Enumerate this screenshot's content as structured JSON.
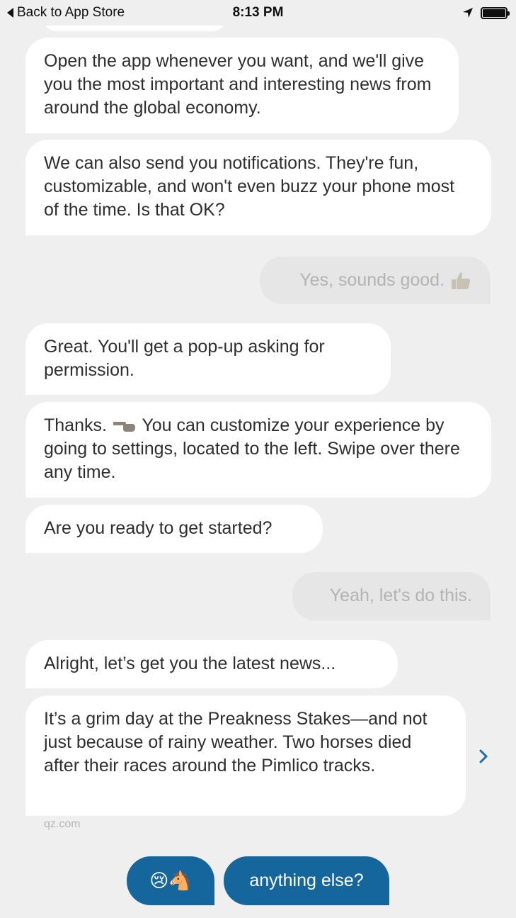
{
  "status_bar": {
    "back_label": "Back to App Store",
    "time": "8:13 PM"
  },
  "messages": [
    {
      "from": "bot",
      "text": "Open the app whenever you want, and we'll give you the most important and interesting news from around the global economy."
    },
    {
      "from": "bot",
      "text": "We can also send you notifications. They're fun, customizable, and won't even buzz your phone most of the time. Is that OK?"
    },
    {
      "from": "user",
      "text": "Yes, sounds good."
    },
    {
      "from": "bot",
      "text": "Great. You'll get a pop-up asking for permission."
    },
    {
      "from": "bot",
      "text_before": "Thanks.",
      "text_after": "You can customize your experience by going to settings, located to the left. Swipe over there any time."
    },
    {
      "from": "bot",
      "text": "Are you ready to get started?"
    },
    {
      "from": "user",
      "text": "Yeah, let's do this."
    },
    {
      "from": "bot",
      "text": "Alright, let’s get you the latest news..."
    },
    {
      "from": "bot",
      "text": "It’s a grim day at the Preakness Stakes—and not just because of rainy weather. Two horses died after their races around the Pimlico tracks.",
      "source": "qz.com"
    }
  ],
  "replies": {
    "emoji_reply": "😢🐴",
    "text_reply": "anything else?"
  },
  "colors": {
    "accent": "#14669d",
    "background": "#efefef",
    "bot_bubble": "#ffffff",
    "user_bubble": "#e6e6e6"
  },
  "icons": [
    "location-arrow-icon",
    "battery-icon",
    "thumbs-up-icon",
    "pointing-hand-icon",
    "chevron-right-icon"
  ]
}
